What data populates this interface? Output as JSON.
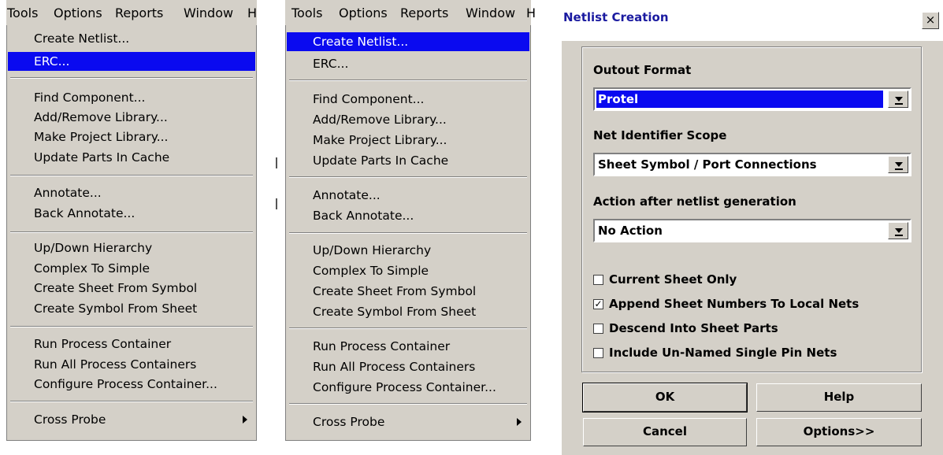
{
  "menu_left": {
    "menubar": [
      "Tools",
      "Options",
      "Reports",
      "Window",
      "H"
    ],
    "items": {
      "create_netlist": "Create Netlist...",
      "erc": "ERC...",
      "find_component": "Find Component...",
      "add_remove_library": "Add/Remove Library...",
      "make_project_library": "Make Project Library...",
      "update_parts": "Update Parts In Cache",
      "annotate": "Annotate...",
      "back_annotate": "Back Annotate...",
      "up_down": "Up/Down Hierarchy",
      "complex_to_simple": "Complex To Simple",
      "sheet_from_symbol": "Create Sheet From Symbol",
      "symbol_from_sheet": "Create Symbol From Sheet",
      "run_process": "Run Process Container",
      "run_all_process": "Run All Process Containers",
      "configure_process": "Configure Process Container...",
      "cross_probe": "Cross Probe"
    },
    "selected": "erc"
  },
  "menu_right": {
    "menubar": [
      "Tools",
      "Options",
      "Reports",
      "Window",
      "H"
    ],
    "items": {
      "create_netlist": "Create Netlist...",
      "erc": "ERC...",
      "find_component": "Find Component...",
      "add_remove_library": "Add/Remove Library...",
      "make_project_library": "Make Project Library...",
      "update_parts": "Update Parts In Cache",
      "annotate": "Annotate...",
      "back_annotate": "Back Annotate...",
      "up_down": "Up/Down Hierarchy",
      "complex_to_simple": "Complex To Simple",
      "sheet_from_symbol": "Create Sheet From Symbol",
      "symbol_from_sheet": "Create Symbol From Sheet",
      "run_process": "Run Process Container",
      "run_all_process": "Run All Process Containers",
      "configure_process": "Configure Process Container...",
      "cross_probe": "Cross Probe"
    },
    "selected": "create_netlist"
  },
  "dialog": {
    "title": "Netlist Creation",
    "close": "×",
    "output_format_label": "Outout Format",
    "output_format_value": "Protel",
    "net_scope_label": "Net Identifier Scope",
    "net_scope_value": "Sheet Symbol / Port Connections",
    "action_label": "Action after netlist generation",
    "action_value": "No Action",
    "checkboxes": [
      {
        "label": "Current Sheet Only",
        "checked": false
      },
      {
        "label": "Append Sheet Numbers To Local Nets",
        "checked": true
      },
      {
        "label": "Descend Into Sheet Parts",
        "checked": false
      },
      {
        "label": "Include Un-Named Single Pin Nets",
        "checked": false
      }
    ],
    "buttons": {
      "ok": "OK",
      "help": "Help",
      "cancel": "Cancel",
      "options": "Options>>"
    }
  },
  "colors": {
    "selection": "#0a0af0",
    "face": "#d4d0c8",
    "title_text": "#1a1aa0"
  }
}
